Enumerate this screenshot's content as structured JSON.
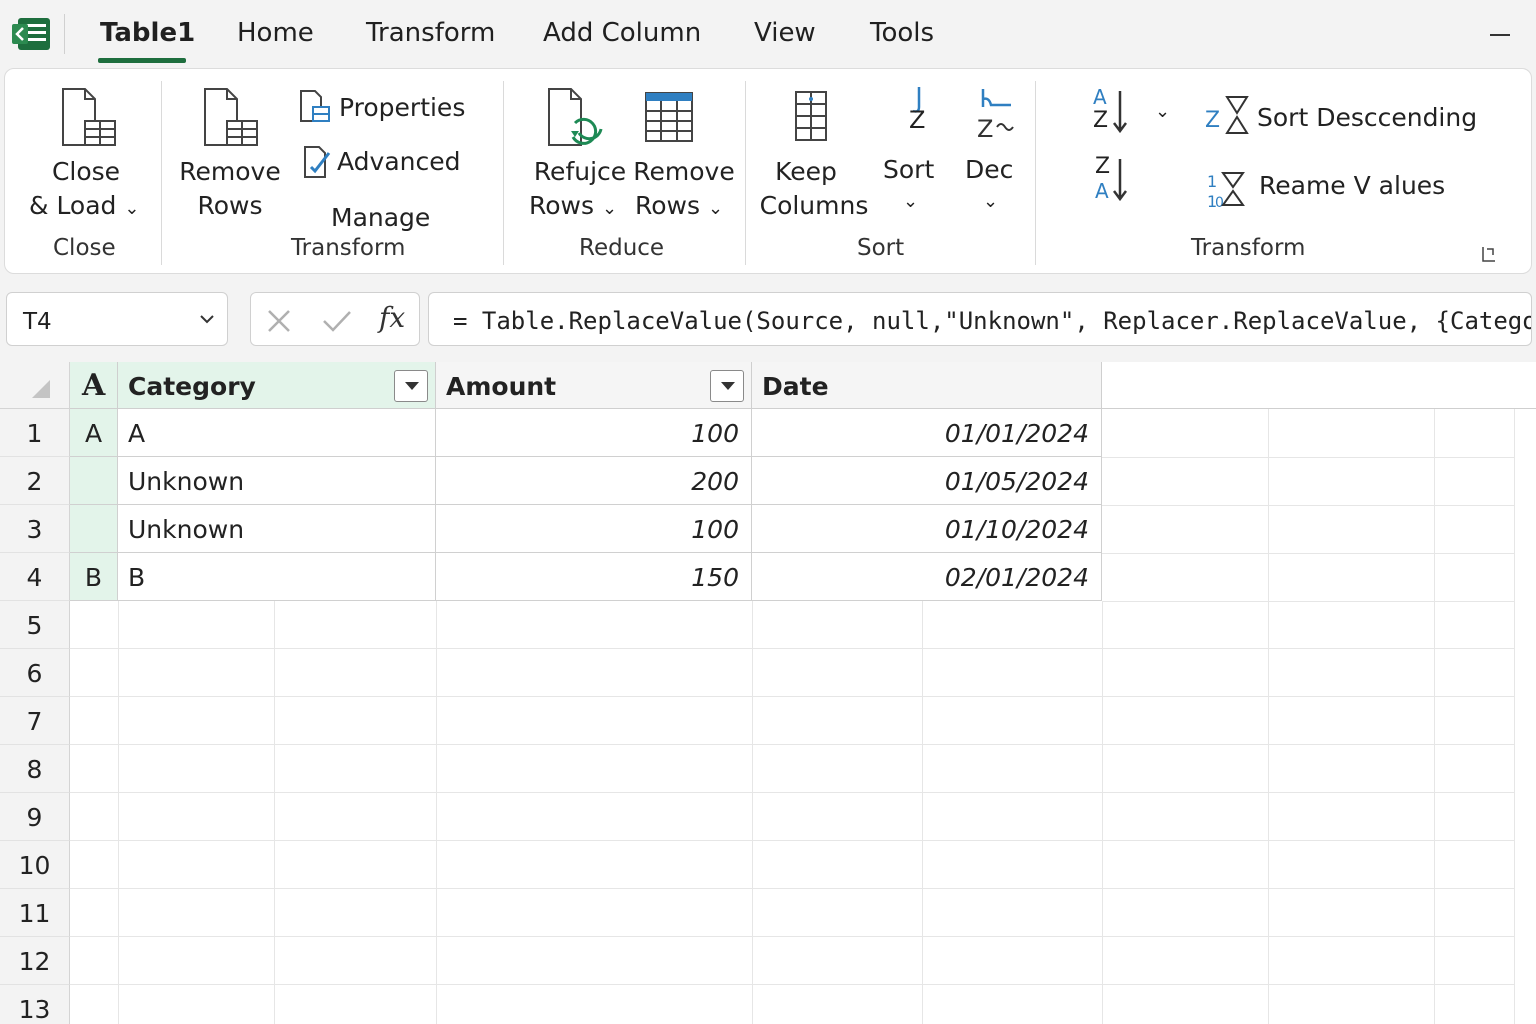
{
  "tabs": [
    "Table1",
    "Home",
    "Transform",
    "Add Column",
    "View",
    "Tools"
  ],
  "ribbon": {
    "close_load": [
      "Close",
      "& Load"
    ],
    "remove_rows": [
      "Remove",
      "Rows"
    ],
    "properties": "Properties",
    "advanced": "Advanced",
    "manage": "Manage",
    "reduce_rows": [
      "Refujce",
      "Rows"
    ],
    "remove_rows2": [
      "Remove",
      "Rows"
    ],
    "keep_columns": [
      "Keep",
      "Columns"
    ],
    "sort": "Sort",
    "dec": "Dec",
    "sort_desc": "Sort Desccending",
    "replace_values": "Reame V alues",
    "az_top": "A",
    "az_bottom": "Z",
    "za_top": "Z",
    "za_bottom": "A",
    "sort_icon_letter": "Z",
    "groups": {
      "close": "Close",
      "transform": "Transform",
      "reduce": "Reduce",
      "sort": "Sort",
      "transform2": "Transform"
    }
  },
  "formula_bar": {
    "name_box": "T4",
    "fx": "fx",
    "formula": "= Table.ReplaceValue(Source, null,\"Unknown\", Replacer.ReplaceValue, {Catego"
  },
  "table": {
    "type_icon": "A",
    "columns": [
      "Category",
      "Amount",
      "Date"
    ],
    "rows": [
      {
        "num": "1",
        "type": "A",
        "category": "A",
        "amount": "100",
        "date": "01/01/2024"
      },
      {
        "num": "2",
        "type": "",
        "category": "Unknown",
        "amount": "200",
        "date": "01/05/2024"
      },
      {
        "num": "3",
        "type": "",
        "category": "Unknown",
        "amount": "100",
        "date": "01/10/2024"
      },
      {
        "num": "4",
        "type": "B",
        "category": "B",
        "amount": "150",
        "date": "02/01/2024"
      }
    ],
    "empty_rows": [
      "5",
      "6",
      "7",
      "8",
      "9",
      "10",
      "11",
      "12",
      "13"
    ]
  },
  "colors": {
    "accent": "#1e6e3e",
    "selected_col": "#e3f4ea",
    "icon_blue": "#2f7fc1"
  }
}
